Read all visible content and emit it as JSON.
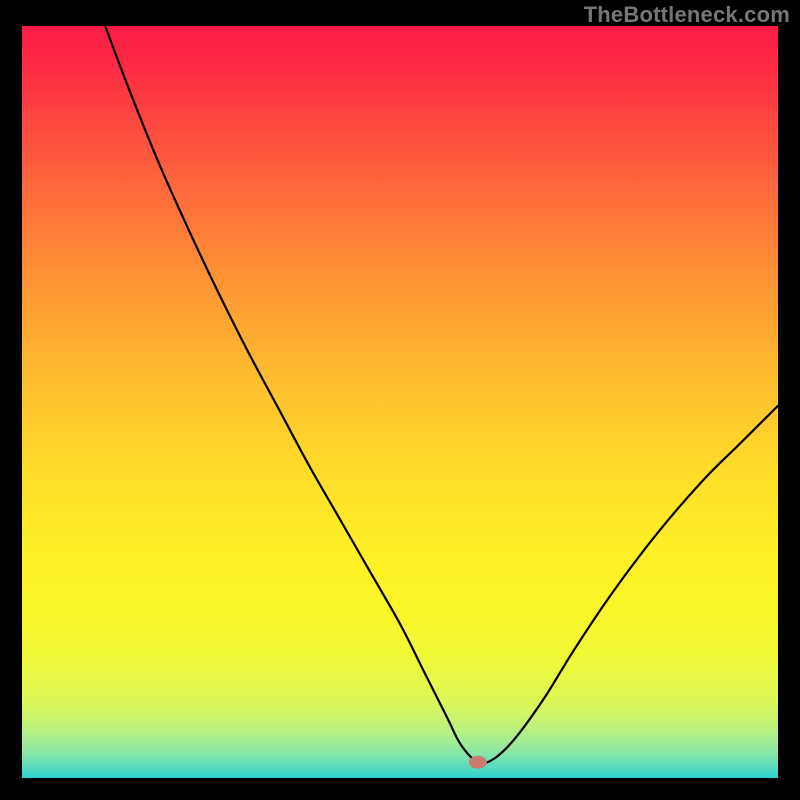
{
  "watermark": "TheBottleneck.com",
  "chart_data": {
    "type": "line",
    "title": "",
    "xlabel": "",
    "ylabel": "",
    "xlim": [
      0,
      100
    ],
    "ylim": [
      0,
      100
    ],
    "curve": {
      "x": [
        11,
        14,
        18,
        22,
        26,
        30,
        34,
        38,
        42,
        46,
        50,
        53,
        55,
        56.5,
        58,
        60,
        62,
        65,
        69,
        73,
        78,
        84,
        90,
        95,
        100
      ],
      "y": [
        100,
        92,
        82,
        73,
        64.5,
        56.5,
        49,
        41.5,
        34.5,
        27.5,
        20.5,
        14.5,
        10.5,
        7.5,
        4.5,
        2.3,
        2.3,
        5,
        10.5,
        17,
        24.5,
        32.5,
        39.5,
        44.5,
        49.5
      ]
    },
    "marker": {
      "x": 60.3,
      "y": 2.1,
      "color": "#cb7a70"
    },
    "background_gradient": {
      "stops": [
        {
          "offset": 0.0,
          "color": "#fc1c47"
        },
        {
          "offset": 0.055,
          "color": "#fd2b43"
        },
        {
          "offset": 0.111,
          "color": "#fd4140"
        },
        {
          "offset": 0.167,
          "color": "#fd563d"
        },
        {
          "offset": 0.222,
          "color": "#fe6b3b"
        },
        {
          "offset": 0.278,
          "color": "#fe7f38"
        },
        {
          "offset": 0.333,
          "color": "#fe9235"
        },
        {
          "offset": 0.389,
          "color": "#fea432"
        },
        {
          "offset": 0.444,
          "color": "#feb530"
        },
        {
          "offset": 0.5,
          "color": "#fec52d"
        },
        {
          "offset": 0.555,
          "color": "#fed32b"
        },
        {
          "offset": 0.611,
          "color": "#fee029"
        },
        {
          "offset": 0.667,
          "color": "#feea27"
        },
        {
          "offset": 0.722,
          "color": "#fdf226"
        },
        {
          "offset": 0.778,
          "color": "#f9f629"
        },
        {
          "offset": 0.833,
          "color": "#f1f835"
        },
        {
          "offset": 0.888,
          "color": "#e0f751"
        },
        {
          "offset": 0.905,
          "color": "#d7f65e"
        },
        {
          "offset": 0.921,
          "color": "#caf46e"
        },
        {
          "offset": 0.937,
          "color": "#b8f181"
        },
        {
          "offset": 0.953,
          "color": "#a0ec95"
        },
        {
          "offset": 0.969,
          "color": "#82e5aa"
        },
        {
          "offset": 0.985,
          "color": "#5bdcbe"
        },
        {
          "offset": 1.0,
          "color": "#2dd0d0"
        }
      ]
    }
  }
}
